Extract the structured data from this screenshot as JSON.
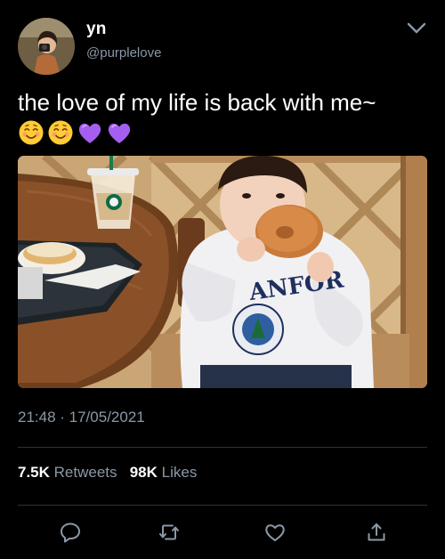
{
  "user": {
    "display_name": "yn",
    "handle": "@purplelove",
    "avatar": "profile-photo"
  },
  "tweet": {
    "text": "the love of my life is back with me~",
    "emojis": [
      "smiling-face-emoji",
      "smiling-face-emoji",
      "purple-heart-emoji",
      "purple-heart-emoji"
    ],
    "media": "photo-child-eating-bagel"
  },
  "meta": {
    "timestamp": "21:48 · 17/05/2021"
  },
  "stats": {
    "retweets_count": "7.5K",
    "retweets_label": "Retweets",
    "likes_count": "98K",
    "likes_label": "Likes"
  },
  "actions": [
    "reply-icon",
    "retweet-icon",
    "like-icon",
    "share-icon"
  ],
  "colors": {
    "background": "#000000",
    "text_primary": "#ffffff",
    "text_secondary": "#8b98a5",
    "divider": "#2f3336"
  }
}
